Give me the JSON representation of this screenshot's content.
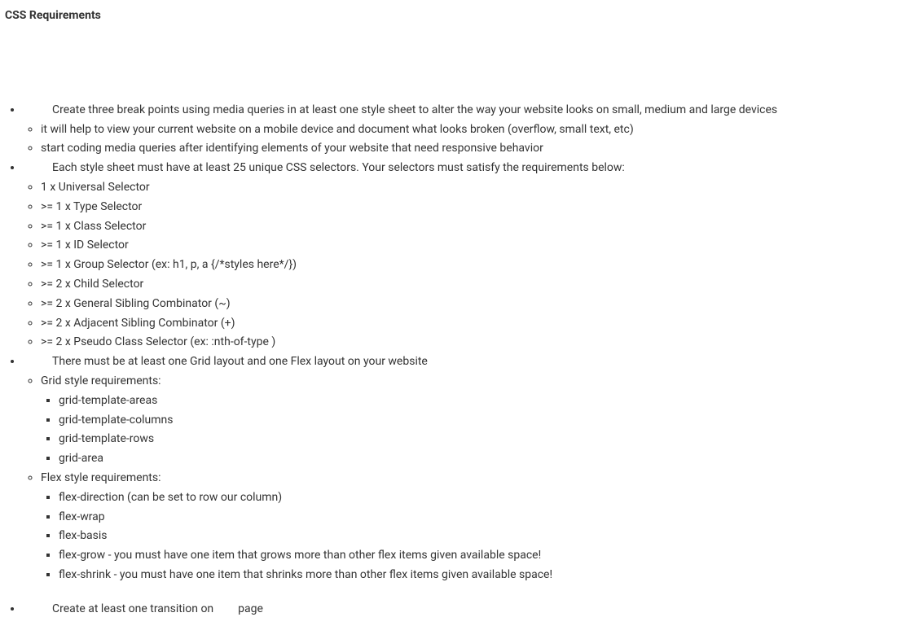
{
  "heading": "CSS Requirements",
  "bullets": [
    {
      "text_pre": "",
      "text": "Create three break points using media queries in at least one style sheet to alter the way your website looks on small, medium and large devices",
      "indent": true,
      "sub": [
        {
          "text": "it will help to view your current website on a mobile device and document what looks broken (overflow, small text, etc)"
        },
        {
          "text": "start coding media queries after identifying elements of your website that need responsive behavior"
        }
      ]
    },
    {
      "text": "Each style sheet must have at least 25 unique CSS selectors. Your selectors must satisfy the requirements below:",
      "indent": true,
      "sub": [
        {
          "text": "1 x Universal Selector"
        },
        {
          "text": ">= 1 x Type Selector"
        },
        {
          "text": ">= 1 x Class Selector"
        },
        {
          "text": ">= 1 x ID Selector"
        },
        {
          "text": ">= 1 x Group Selector (ex: h1, p, a {/*styles here*/})"
        },
        {
          "text": ">= 2 x Child Selector"
        },
        {
          "text": ">= 2 x General Sibling Combinator (~)"
        },
        {
          "text": ">= 2 x Adjacent Sibling Combinator (+)"
        },
        {
          "text": ">= 2 x Pseudo Class Selector (ex: :nth-of-type )"
        }
      ]
    },
    {
      "text": "There must be at least one Grid layout and one Flex layout on your website",
      "indent": true,
      "sub": [
        {
          "text": "Grid style requirements:",
          "sub": [
            {
              "text": "grid-template-areas"
            },
            {
              "text": "grid-template-columns"
            },
            {
              "text": "grid-template-rows"
            },
            {
              "text": "grid-area"
            }
          ]
        },
        {
          "text": "Flex style requirements:",
          "sub": [
            {
              "text": "flex-direction (can be set to row our column)"
            },
            {
              "text": "flex-wrap"
            },
            {
              "text": "flex-basis"
            },
            {
              "text": "flex-grow - you must have one item that grows more than other flex items given available space!"
            },
            {
              "text": "flex-shrink - you must have one item that shrinks more than other flex items given available space!"
            }
          ]
        }
      ]
    },
    {
      "text_parts": [
        "Create at least one transition on",
        "page"
      ],
      "indent": true,
      "gap": true
    }
  ]
}
